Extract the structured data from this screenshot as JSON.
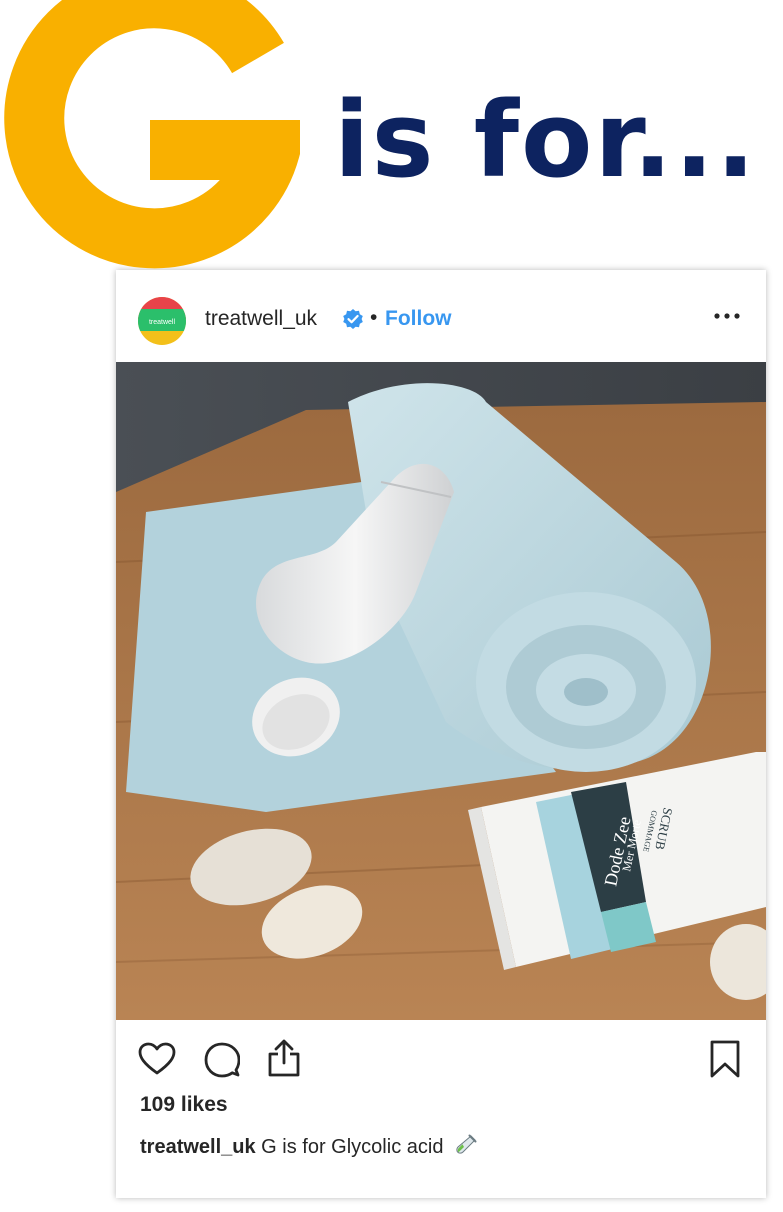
{
  "headline": {
    "letter": "G",
    "rest": "is for...",
    "colors": {
      "letter": "#f9b000",
      "rest": "#0d2360"
    }
  },
  "post": {
    "username": "treatwell_uk",
    "separator": "•",
    "follow_label": "Follow",
    "more_icon": "more-horizontal-icon",
    "verified_icon": "verified-badge-icon",
    "avatar_label": "treatwell",
    "likes_text": "109 likes",
    "caption_user": "treatwell_uk",
    "caption_text": "G is for Glycolic acid",
    "caption_emoji": "test-tube-icon",
    "actions": [
      "heart-icon",
      "comment-icon",
      "share-icon",
      "bookmark-icon"
    ],
    "colors": {
      "link": "#3897f0",
      "text": "#262626"
    }
  },
  "photo": {
    "tube_text": {
      "title": "Dode Zee",
      "subtitle": "Mer Morte",
      "product": "SCRUB",
      "product_sub": "GOMMAGE"
    }
  }
}
